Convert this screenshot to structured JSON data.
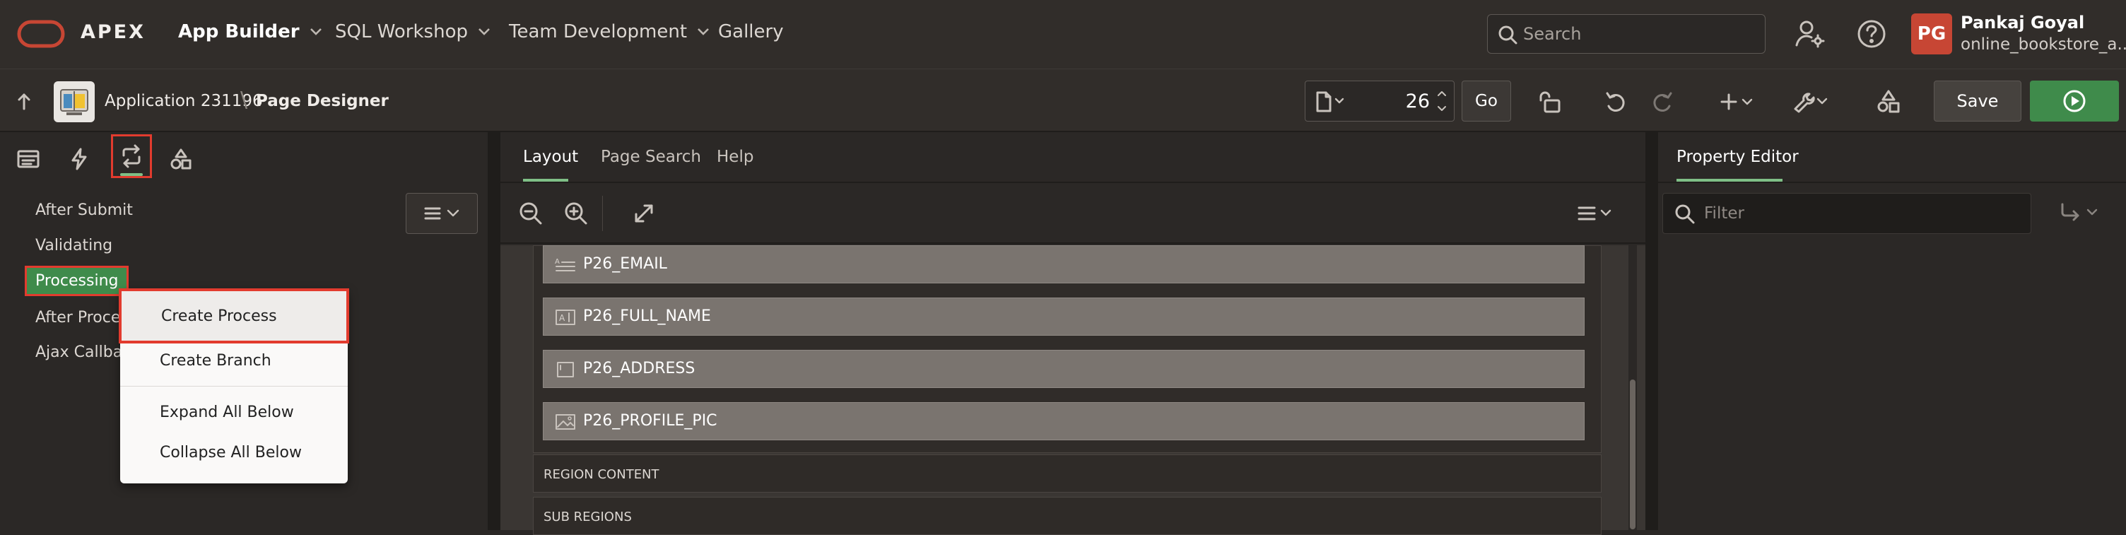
{
  "top_nav": {
    "brand": "APEX",
    "items": [
      {
        "label": "App Builder",
        "active": true,
        "has_menu": true
      },
      {
        "label": "SQL Workshop",
        "has_menu": true
      },
      {
        "label": "Team Development",
        "has_menu": true
      },
      {
        "label": "Gallery",
        "has_menu": false
      }
    ],
    "search_placeholder": "Search",
    "user": {
      "initials": "PG",
      "name": "Pankaj Goyal",
      "workspace": "online_bookstore_a..."
    },
    "icons": [
      "oracle-logo-icon",
      "admin-user-icon",
      "help-icon"
    ]
  },
  "page_designer_bar": {
    "application": "Application 231196",
    "separator": "\\",
    "title": "Page Designer",
    "page_number": "26",
    "go_label": "Go",
    "save_label": "Save",
    "icons": [
      "up-arrow-icon",
      "app-icon",
      "page-icon",
      "lock-icon",
      "undo-icon",
      "redo-icon",
      "create-icon",
      "utilities-icon",
      "shared-components-icon",
      "run-icon"
    ]
  },
  "left_pane": {
    "tabs": [
      {
        "icon": "rendering-tab-icon"
      },
      {
        "icon": "dynamic-actions-tab-icon"
      },
      {
        "icon": "processing-tab-icon",
        "active": true
      },
      {
        "icon": "shared-components-tab-icon"
      }
    ],
    "tree": [
      {
        "label": "After Submit"
      },
      {
        "label": "Validating"
      },
      {
        "label": "Processing",
        "selected": true
      },
      {
        "label": "After Processing"
      },
      {
        "label": "Ajax Callback"
      }
    ],
    "context_menu": [
      {
        "label": "Create Process",
        "highlighted": true
      },
      {
        "label": "Create Branch"
      },
      {
        "label": "Expand All Below"
      },
      {
        "label": "Collapse All Below"
      }
    ]
  },
  "center_pane": {
    "tabs": [
      {
        "label": "Layout",
        "active": true
      },
      {
        "label": "Page Search"
      },
      {
        "label": "Help"
      }
    ],
    "fields": [
      {
        "label": "P26_EMAIL",
        "icon": "text-field-icon"
      },
      {
        "label": "P26_FULL_NAME",
        "icon": "text-item-icon"
      },
      {
        "label": "P26_ADDRESS",
        "icon": "textarea-icon"
      },
      {
        "label": "P26_PROFILE_PIC",
        "icon": "image-upload-icon"
      }
    ],
    "region_bars": [
      "REGION CONTENT",
      "SUB REGIONS"
    ]
  },
  "right_pane": {
    "title": "Property Editor",
    "filter_placeholder": "Filter"
  }
}
